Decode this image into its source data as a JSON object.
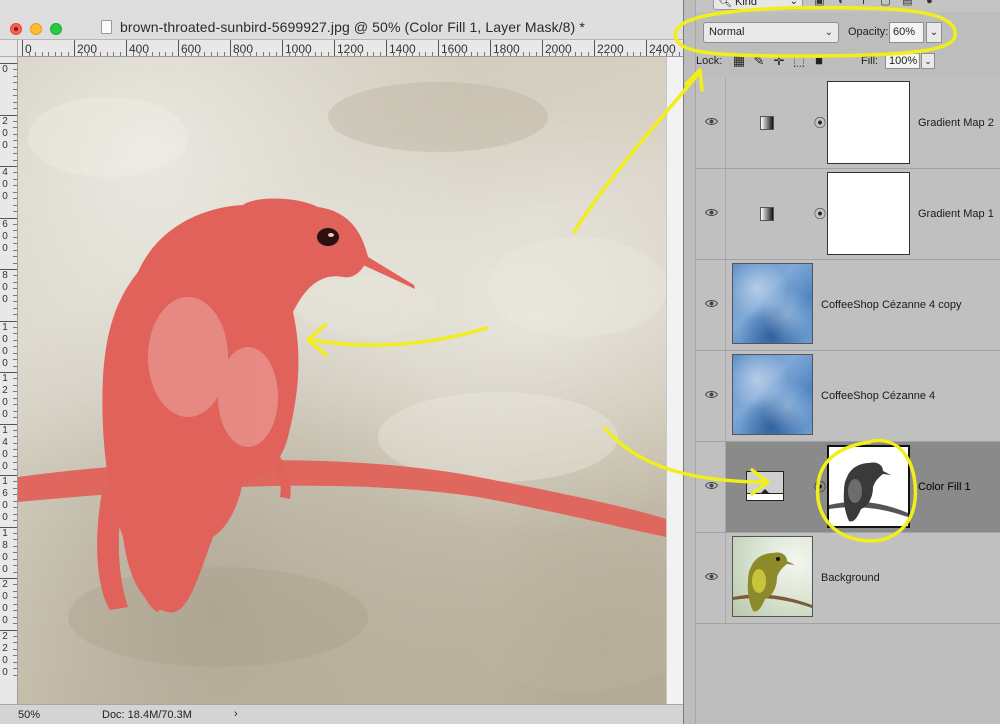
{
  "document": {
    "title": "brown-throated-sunbird-5699927.jpg @ 50% (Color Fill 1, Layer Mask/8) *",
    "ruler_h_labels": [
      "0",
      "200",
      "400",
      "600",
      "800",
      "1000",
      "1200",
      "1400",
      "1600",
      "1800",
      "2000",
      "2200",
      "2400"
    ],
    "ruler_v_labels": [
      "0",
      "2 0 0",
      "4 0 0",
      "6 0 0",
      "8 0 0",
      "1 0 0 0",
      "1 2 0 0",
      "1 4 0 0",
      "1 6 0 0",
      "1 8 0 0",
      "2 0 0 0",
      "2 2 0 0"
    ],
    "status": {
      "zoom": "50%",
      "doc_size": "Doc: 18.4M/70.3M",
      "arrow": "›"
    }
  },
  "layers_panel": {
    "filter_kind": "Kind",
    "blend_mode": "Normal",
    "opacity_label": "Opacity:",
    "opacity_value": "60%",
    "lock_label": "Lock:",
    "fill_label": "Fill:",
    "fill_value": "100%",
    "layers": [
      {
        "name": "Gradient Map 2",
        "kind": "adjustment",
        "visible": true,
        "selected": false
      },
      {
        "name": "Gradient Map 1",
        "kind": "adjustment",
        "visible": true,
        "selected": false
      },
      {
        "name": "CoffeeShop Cézanne 4 copy",
        "kind": "pixel",
        "visible": true,
        "selected": false
      },
      {
        "name": "CoffeeShop Cézanne 4",
        "kind": "pixel",
        "visible": true,
        "selected": false
      },
      {
        "name": "Color Fill 1",
        "kind": "fill",
        "visible": true,
        "selected": true
      },
      {
        "name": "Background",
        "kind": "pixel",
        "visible": true,
        "selected": false
      }
    ]
  },
  "colors": {
    "annotation": "#f2ee1c",
    "bird_overlay": "#e0625a",
    "selected_layer": "#8a8a8a"
  }
}
